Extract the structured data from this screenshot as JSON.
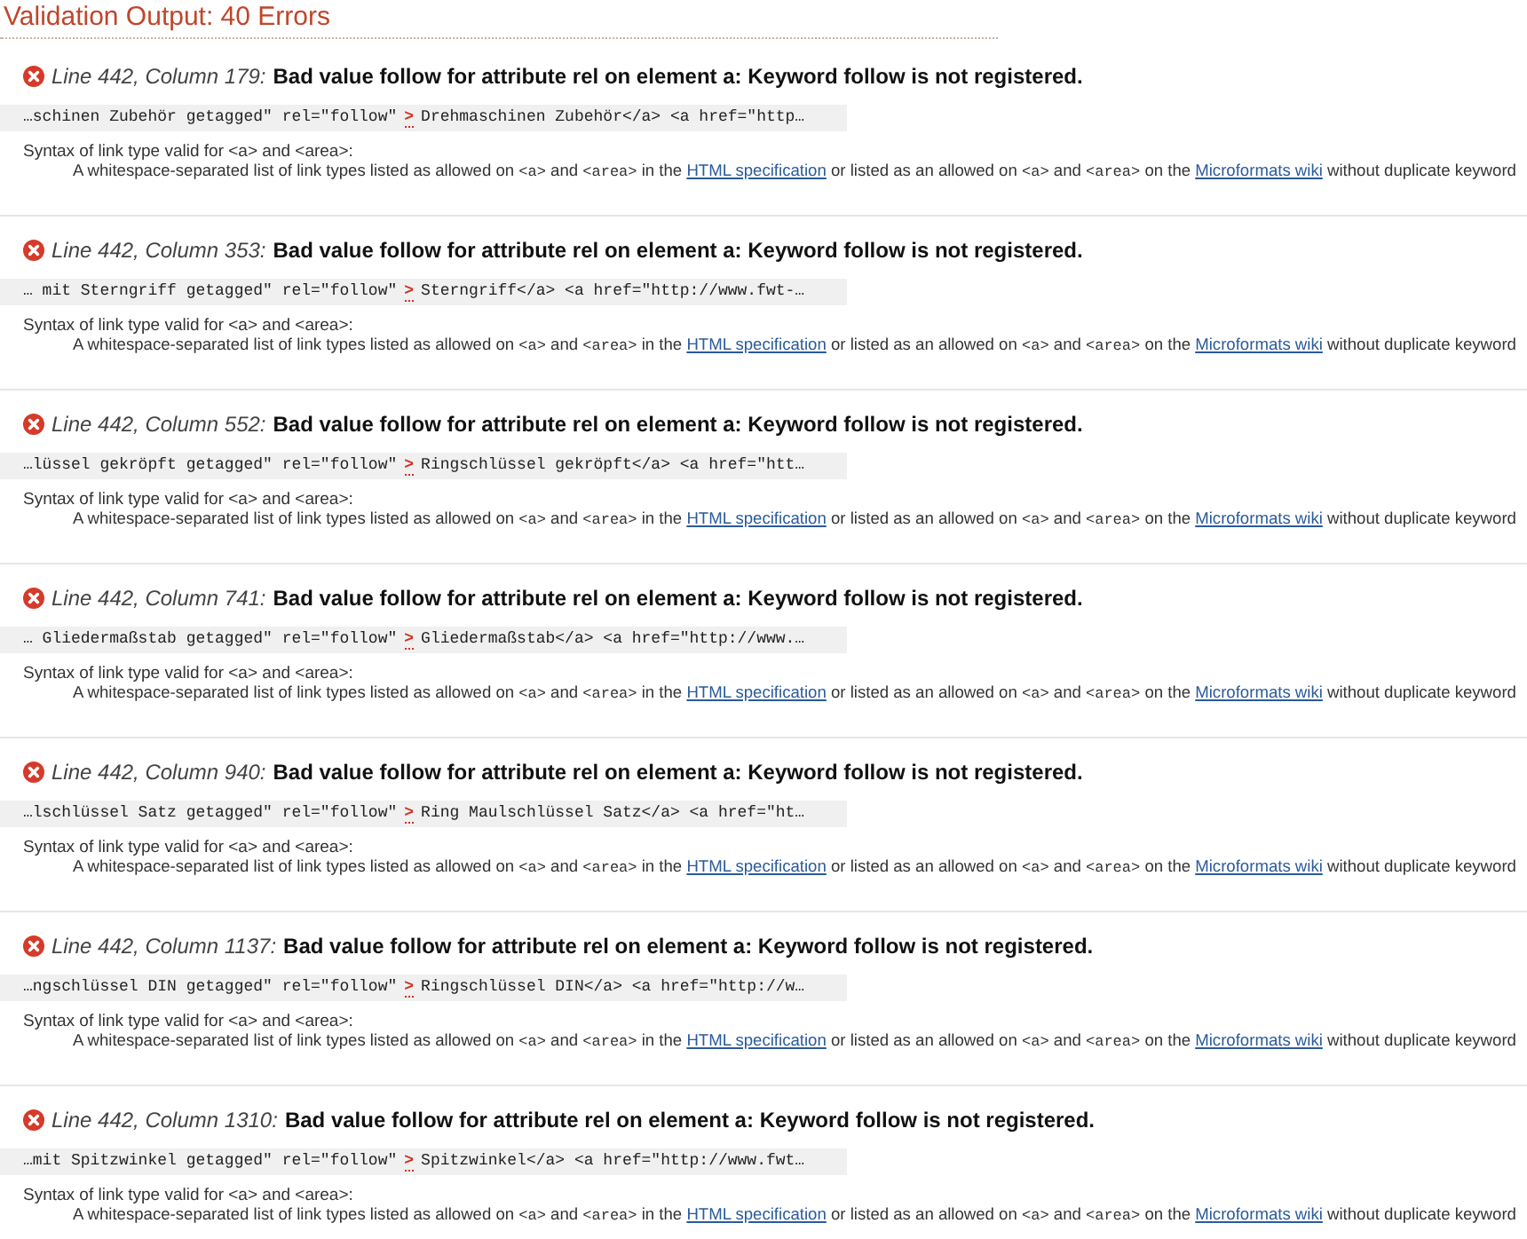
{
  "header": {
    "title": "Validation Output: 40 Errors"
  },
  "errors": [
    {
      "location": "Line 442, Column 179:",
      "message": "Bad value follow for attribute rel on element a: Keyword follow is not registered.",
      "extract": {
        "before": "…schinen Zubehör getagged\" rel=\"follow\"",
        "marker": ">",
        "after": "Drehmaschinen Zubehör</a> <a href=\"http…"
      },
      "syntax": "Syntax of link type valid for <a> and <area>:",
      "description": [
        {
          "kind": "text",
          "text": "A whitespace-separated list of link types listed as allowed on "
        },
        {
          "kind": "code",
          "text": "<a>"
        },
        {
          "kind": "text",
          "text": " and "
        },
        {
          "kind": "code",
          "text": "<area>"
        },
        {
          "kind": "text",
          "text": " in the "
        },
        {
          "kind": "link",
          "text": "HTML specification"
        },
        {
          "kind": "text",
          "text": " or listed as an allowed on "
        },
        {
          "kind": "code",
          "text": "<a>"
        },
        {
          "kind": "text",
          "text": " and "
        },
        {
          "kind": "code",
          "text": "<area>"
        },
        {
          "kind": "text",
          "text": " on the "
        },
        {
          "kind": "link",
          "text": "Microformats wiki"
        },
        {
          "kind": "text",
          "text": " without duplicate keyword"
        }
      ]
    },
    {
      "location": "Line 442, Column 353:",
      "message": "Bad value follow for attribute rel on element a: Keyword follow is not registered.",
      "extract": {
        "before": "… mit Sterngriff getagged\" rel=\"follow\"",
        "marker": ">",
        "after": "Sterngriff</a> <a href=\"http://www.fwt-…"
      },
      "syntax": "Syntax of link type valid for <a> and <area>:",
      "description": [
        {
          "kind": "text",
          "text": "A whitespace-separated list of link types listed as allowed on "
        },
        {
          "kind": "code",
          "text": "<a>"
        },
        {
          "kind": "text",
          "text": " and "
        },
        {
          "kind": "code",
          "text": "<area>"
        },
        {
          "kind": "text",
          "text": " in the "
        },
        {
          "kind": "link",
          "text": "HTML specification"
        },
        {
          "kind": "text",
          "text": " or listed as an allowed on "
        },
        {
          "kind": "code",
          "text": "<a>"
        },
        {
          "kind": "text",
          "text": " and "
        },
        {
          "kind": "code",
          "text": "<area>"
        },
        {
          "kind": "text",
          "text": " on the "
        },
        {
          "kind": "link",
          "text": "Microformats wiki"
        },
        {
          "kind": "text",
          "text": " without duplicate keyword"
        }
      ]
    },
    {
      "location": "Line 442, Column 552:",
      "message": "Bad value follow for attribute rel on element a: Keyword follow is not registered.",
      "extract": {
        "before": "…lüssel gekröpft getagged\" rel=\"follow\"",
        "marker": ">",
        "after": "Ringschlüssel gekröpft</a> <a href=\"htt…"
      },
      "syntax": "Syntax of link type valid for <a> and <area>:",
      "description": [
        {
          "kind": "text",
          "text": "A whitespace-separated list of link types listed as allowed on "
        },
        {
          "kind": "code",
          "text": "<a>"
        },
        {
          "kind": "text",
          "text": " and "
        },
        {
          "kind": "code",
          "text": "<area>"
        },
        {
          "kind": "text",
          "text": " in the "
        },
        {
          "kind": "link",
          "text": "HTML specification"
        },
        {
          "kind": "text",
          "text": " or listed as an allowed on "
        },
        {
          "kind": "code",
          "text": "<a>"
        },
        {
          "kind": "text",
          "text": " and "
        },
        {
          "kind": "code",
          "text": "<area>"
        },
        {
          "kind": "text",
          "text": " on the "
        },
        {
          "kind": "link",
          "text": "Microformats wiki"
        },
        {
          "kind": "text",
          "text": " without duplicate keyword"
        }
      ]
    },
    {
      "location": "Line 442, Column 741:",
      "message": "Bad value follow for attribute rel on element a: Keyword follow is not registered.",
      "extract": {
        "before": "… Gliedermaßstab getagged\" rel=\"follow\"",
        "marker": ">",
        "after": "Gliedermaßstab</a> <a href=\"http://www.…"
      },
      "syntax": "Syntax of link type valid for <a> and <area>:",
      "description": [
        {
          "kind": "text",
          "text": "A whitespace-separated list of link types listed as allowed on "
        },
        {
          "kind": "code",
          "text": "<a>"
        },
        {
          "kind": "text",
          "text": " and "
        },
        {
          "kind": "code",
          "text": "<area>"
        },
        {
          "kind": "text",
          "text": " in the "
        },
        {
          "kind": "link",
          "text": "HTML specification"
        },
        {
          "kind": "text",
          "text": " or listed as an allowed on "
        },
        {
          "kind": "code",
          "text": "<a>"
        },
        {
          "kind": "text",
          "text": " and "
        },
        {
          "kind": "code",
          "text": "<area>"
        },
        {
          "kind": "text",
          "text": " on the "
        },
        {
          "kind": "link",
          "text": "Microformats wiki"
        },
        {
          "kind": "text",
          "text": " without duplicate keyword"
        }
      ]
    },
    {
      "location": "Line 442, Column 940:",
      "message": "Bad value follow for attribute rel on element a: Keyword follow is not registered.",
      "extract": {
        "before": "…lschlüssel Satz getagged\" rel=\"follow\"",
        "marker": ">",
        "after": "Ring Maulschlüssel Satz</a> <a href=\"ht…"
      },
      "syntax": "Syntax of link type valid for <a> and <area>:",
      "description": [
        {
          "kind": "text",
          "text": "A whitespace-separated list of link types listed as allowed on "
        },
        {
          "kind": "code",
          "text": "<a>"
        },
        {
          "kind": "text",
          "text": " and "
        },
        {
          "kind": "code",
          "text": "<area>"
        },
        {
          "kind": "text",
          "text": " in the "
        },
        {
          "kind": "link",
          "text": "HTML specification"
        },
        {
          "kind": "text",
          "text": " or listed as an allowed on "
        },
        {
          "kind": "code",
          "text": "<a>"
        },
        {
          "kind": "text",
          "text": " and "
        },
        {
          "kind": "code",
          "text": "<area>"
        },
        {
          "kind": "text",
          "text": " on the "
        },
        {
          "kind": "link",
          "text": "Microformats wiki"
        },
        {
          "kind": "text",
          "text": " without duplicate keyword"
        }
      ]
    },
    {
      "location": "Line 442, Column 1137:",
      "message": "Bad value follow for attribute rel on element a: Keyword follow is not registered.",
      "extract": {
        "before": "…ngschlüssel DIN getagged\" rel=\"follow\"",
        "marker": ">",
        "after": "Ringschlüssel DIN</a> <a href=\"http://w…"
      },
      "syntax": "Syntax of link type valid for <a> and <area>:",
      "description": [
        {
          "kind": "text",
          "text": "A whitespace-separated list of link types listed as allowed on "
        },
        {
          "kind": "code",
          "text": "<a>"
        },
        {
          "kind": "text",
          "text": " and "
        },
        {
          "kind": "code",
          "text": "<area>"
        },
        {
          "kind": "text",
          "text": " in the "
        },
        {
          "kind": "link",
          "text": "HTML specification"
        },
        {
          "kind": "text",
          "text": " or listed as an allowed on "
        },
        {
          "kind": "code",
          "text": "<a>"
        },
        {
          "kind": "text",
          "text": " and "
        },
        {
          "kind": "code",
          "text": "<area>"
        },
        {
          "kind": "text",
          "text": " on the "
        },
        {
          "kind": "link",
          "text": "Microformats wiki"
        },
        {
          "kind": "text",
          "text": " without duplicate keyword"
        }
      ]
    },
    {
      "location": "Line 442, Column 1310:",
      "message": "Bad value follow for attribute rel on element a: Keyword follow is not registered.",
      "extract": {
        "before": "…mit Spitzwinkel getagged\" rel=\"follow\"",
        "marker": ">",
        "after": "Spitzwinkel</a> <a href=\"http://www.fwt…"
      },
      "syntax": "Syntax of link type valid for <a> and <area>:",
      "description": [
        {
          "kind": "text",
          "text": "A whitespace-separated list of link types listed as allowed on "
        },
        {
          "kind": "code",
          "text": "<a>"
        },
        {
          "kind": "text",
          "text": " and "
        },
        {
          "kind": "code",
          "text": "<area>"
        },
        {
          "kind": "text",
          "text": " in the "
        },
        {
          "kind": "link",
          "text": "HTML specification"
        },
        {
          "kind": "text",
          "text": " or listed as an allowed on "
        },
        {
          "kind": "code",
          "text": "<a>"
        },
        {
          "kind": "text",
          "text": " and "
        },
        {
          "kind": "code",
          "text": "<area>"
        },
        {
          "kind": "text",
          "text": " on the "
        },
        {
          "kind": "link",
          "text": "Microformats wiki"
        },
        {
          "kind": "text",
          "text": " without duplicate keyword"
        }
      ]
    }
  ]
}
